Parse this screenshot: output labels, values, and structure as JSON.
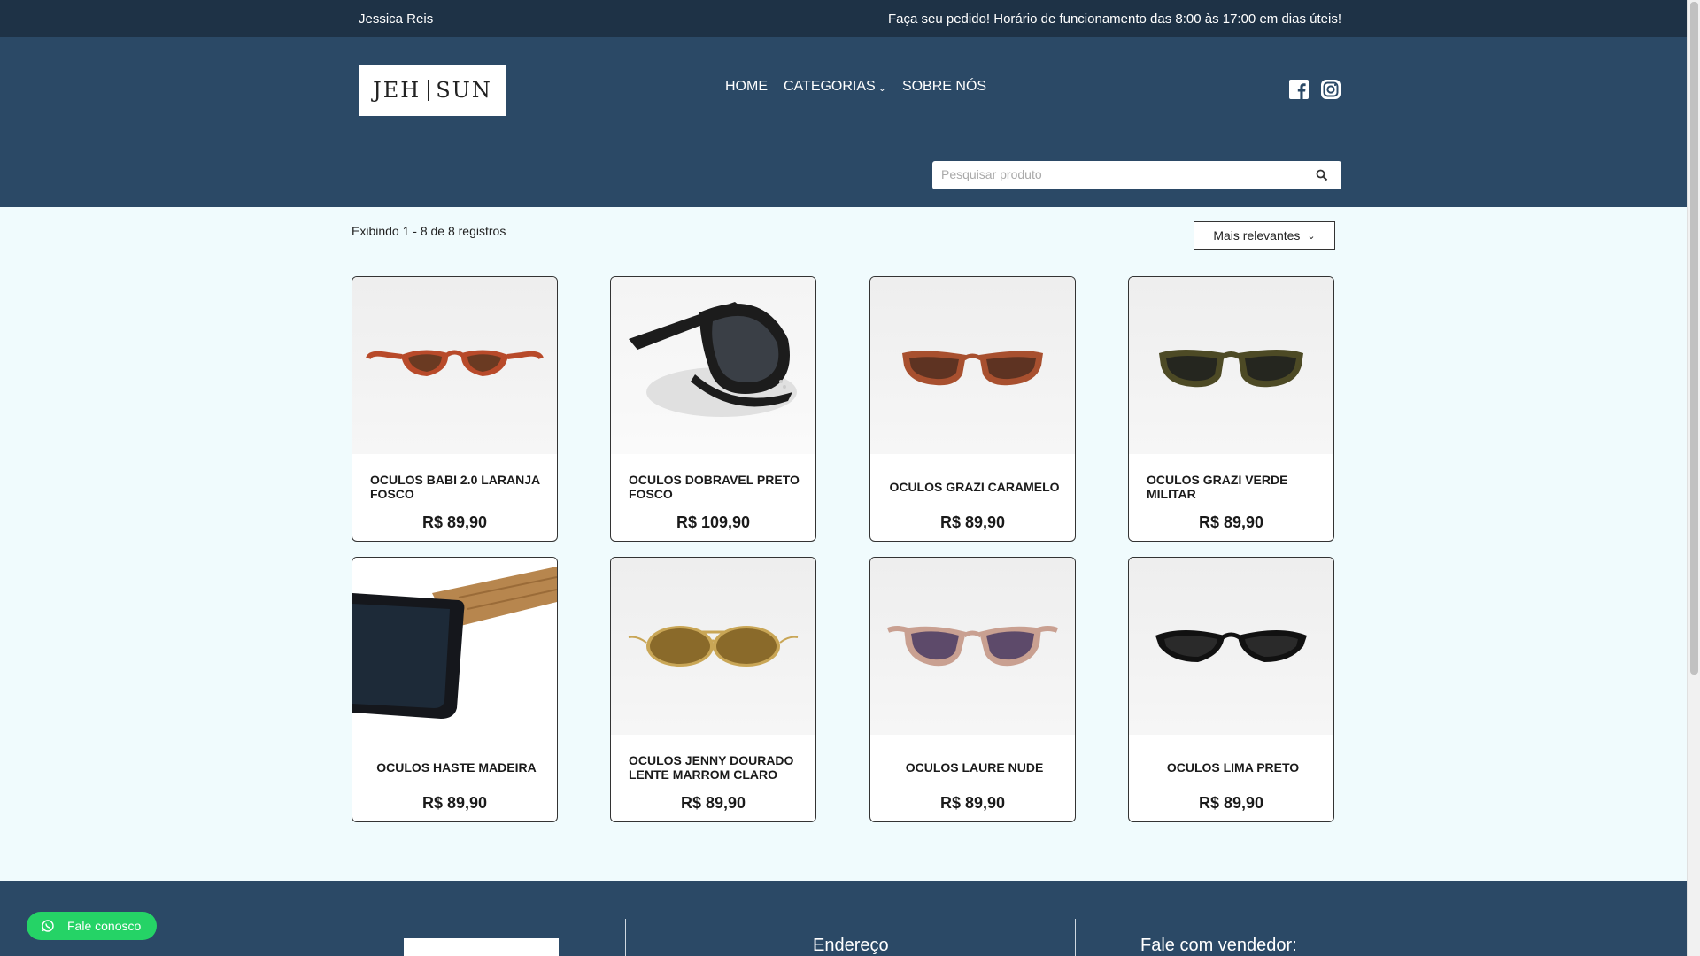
{
  "topbar": {
    "user": "Jessica Reis",
    "notice": "Faça seu pedido! Horário de funcionamento das 8:00 às 17:00 em dias úteis!"
  },
  "header": {
    "logo_left": "JEH",
    "logo_right": "SUN",
    "nav": [
      {
        "label": "HOME"
      },
      {
        "label": "CATEGORIAS",
        "icon": "chevron-down-icon"
      },
      {
        "label": "SOBRE NÓS"
      }
    ],
    "social": [
      "facebook-icon",
      "instagram-icon"
    ],
    "search_placeholder": "Pesquisar produto"
  },
  "listing": {
    "results_text": "Exibindo 1 - 8 de 8 registros",
    "sort_label": "Mais relevantes"
  },
  "products": [
    {
      "name": "OCULOS BABI 2.0 LARANJA FOSCO",
      "price": "R$ 89,90",
      "frame_color": "#b84a2a",
      "lens_color": "#6a3a22"
    },
    {
      "name": "OCULOS DOBRAVEL PRETO FOSCO",
      "price": "R$ 109,90",
      "frame_color": "#1c1c1c",
      "lens_color": "#3a3f46"
    },
    {
      "name": "OCULOS GRAZI CARAMELO",
      "price": "R$ 89,90",
      "frame_color": "#a8502f",
      "lens_color": "#5e3322"
    },
    {
      "name": "OCULOS GRAZI VERDE MILITAR",
      "price": "R$ 89,90",
      "frame_color": "#4d4a25",
      "lens_color": "#25261f"
    },
    {
      "name": "OCULOS HASTE MADEIRA",
      "price": "R$ 89,90",
      "frame_color": "#15171c",
      "lens_color": "#1d2a38"
    },
    {
      "name": "OCULOS JENNY DOURADO LENTE MARROM CLARO",
      "price": "R$ 89,90",
      "frame_color": "#c9a656",
      "lens_color": "#8a6a2a"
    },
    {
      "name": "OCULOS LAURE NUDE",
      "price": "R$ 89,90",
      "frame_color": "#c9a091",
      "lens_color": "#5d4a6a"
    },
    {
      "name": "OCULOS LIMA PRETO",
      "price": "R$ 89,90",
      "frame_color": "#111111",
      "lens_color": "#2a2a2a"
    }
  ],
  "footer": {
    "address_title": "Endereço",
    "contact_title": "Fale com vendedor:"
  },
  "whatsapp": {
    "label": "Fale conosco",
    "icon": "whatsapp-icon"
  }
}
